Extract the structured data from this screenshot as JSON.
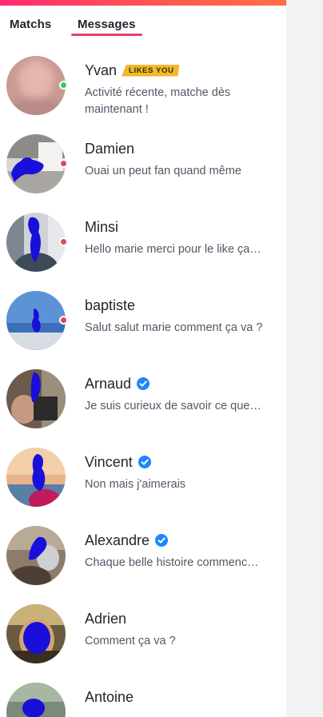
{
  "tabs": {
    "matchs": "Matchs",
    "messages": "Messages"
  },
  "colors": {
    "online": "#2ed15c",
    "unread": "#e2475a",
    "verified": "#1f86ff",
    "badge": "#f0b92b"
  },
  "messages": [
    {
      "name": "Yvan",
      "badge": "LIKES YOU",
      "preview": "Activité récente, matche dès maintenant !",
      "status": "online",
      "verified": false
    },
    {
      "name": "Damien",
      "preview": "Ouai un peut fan quand même",
      "status": "unread",
      "verified": false
    },
    {
      "name": "Minsi",
      "preview": "Hello marie merci pour le like ça…",
      "status": "unread",
      "verified": false
    },
    {
      "name": "baptiste",
      "preview": "Salut salut marie comment ça va ?",
      "status": "unread",
      "verified": false
    },
    {
      "name": "Arnaud",
      "preview": "Je suis curieux de savoir ce que…",
      "status": "none",
      "verified": true
    },
    {
      "name": "Vincent",
      "preview": "Non mais j'aimerais",
      "status": "none",
      "verified": true
    },
    {
      "name": "Alexandre",
      "preview": "Chaque belle histoire commenc…",
      "status": "none",
      "verified": true
    },
    {
      "name": "Adrien",
      "preview": "Comment ça va ?",
      "status": "none",
      "verified": false
    },
    {
      "name": "Antoine",
      "preview": "",
      "status": "none",
      "verified": false
    }
  ]
}
